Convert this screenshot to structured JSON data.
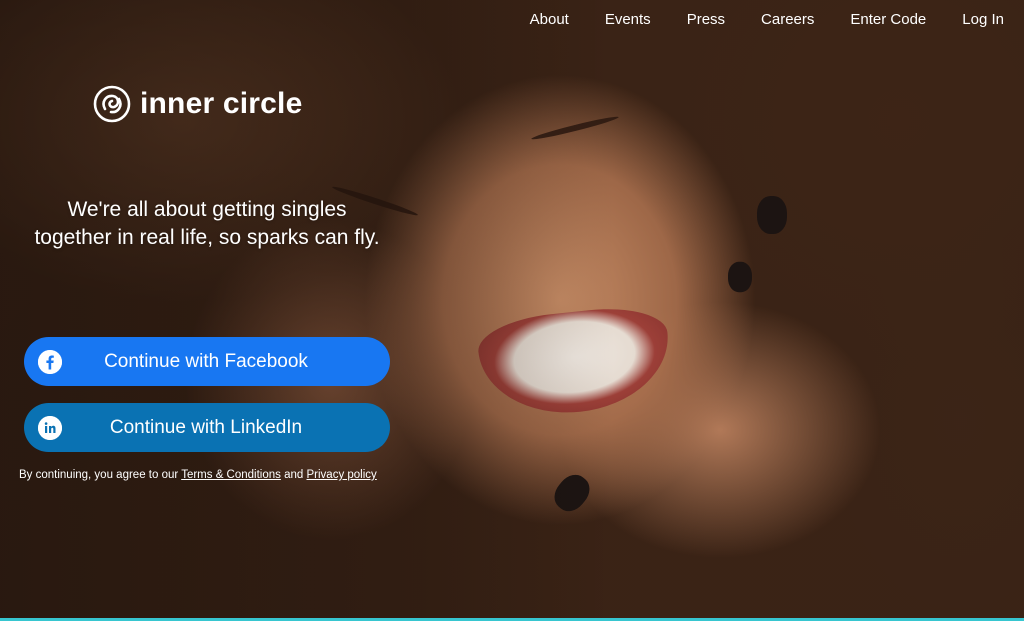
{
  "nav": {
    "items": [
      {
        "label": "About"
      },
      {
        "label": "Events"
      },
      {
        "label": "Press"
      },
      {
        "label": "Careers"
      },
      {
        "label": "Enter Code"
      },
      {
        "label": "Log In"
      }
    ]
  },
  "brand": {
    "name": "inner circle",
    "icon": "inner-circle-logo-icon"
  },
  "hero": {
    "tagline_line1": "We're all about getting singles",
    "tagline_line2": "together in real life, so sparks can fly."
  },
  "auth": {
    "facebook_label": "Continue with Facebook",
    "facebook_icon": "facebook-icon",
    "facebook_color": "#1877f2",
    "linkedin_label": "Continue with LinkedIn",
    "linkedin_icon": "linkedin-icon",
    "linkedin_color": "#0a72b3"
  },
  "legal": {
    "prefix": "By continuing, you agree to our",
    "terms_label": "Terms & Conditions",
    "conjunction": "and",
    "privacy_label": "Privacy policy"
  },
  "colors": {
    "accent_strip": "#37c6d0"
  }
}
